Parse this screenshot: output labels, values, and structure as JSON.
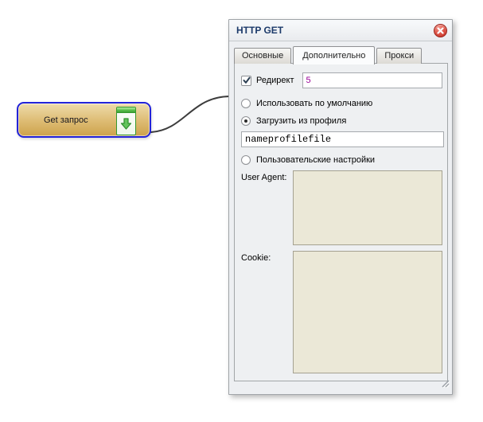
{
  "node": {
    "label": "Get запрос"
  },
  "dialog": {
    "title": "HTTP GET",
    "tabs": [
      {
        "label": "Основные",
        "active": false
      },
      {
        "label": "Дополнительно",
        "active": true
      },
      {
        "label": "Прокси",
        "active": false
      }
    ],
    "advanced": {
      "redirect_label": "Редирект",
      "redirect_checked": true,
      "redirect_value": "5",
      "radios": [
        {
          "label": "Использовать по умолчанию",
          "selected": false
        },
        {
          "label": "Загрузить из профиля",
          "selected": true
        },
        {
          "label": "Пользовательские настройки",
          "selected": false
        }
      ],
      "profile_value": "nameprofilefile",
      "user_agent_label": "User Agent:",
      "user_agent_value": "",
      "cookie_label": "Cookie:",
      "cookie_value": ""
    }
  },
  "icons": {
    "close": "close-icon",
    "node_icon": "download-page-icon",
    "scroll_up": "▲",
    "scroll_down": "▼"
  },
  "colors": {
    "node_selection_border": "#2323d9",
    "node_gold": "#cfa24b",
    "close_red": "#c02d22",
    "redirect_value_color": "#990098",
    "textarea_bg": "#ebe8d7",
    "connector": "#3d3d3d",
    "title_color": "#1c3a6a"
  }
}
